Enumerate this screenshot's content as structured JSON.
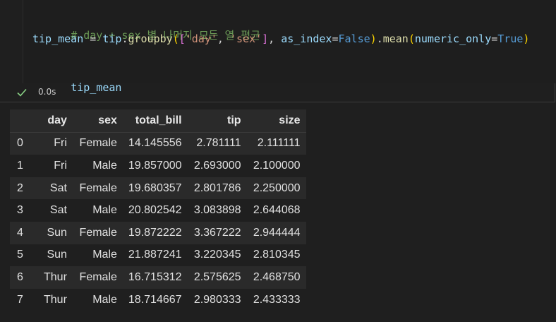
{
  "code": {
    "comment": "# day + sex 별 나머지 모든 열 평균",
    "line2": {
      "var": "tip_mean",
      "eq": " = ",
      "obj": "tip",
      "dot1": ".",
      "method1": "groupby",
      "open_paren": "(",
      "open_bracket": "[",
      "str1": "'day'",
      "comma1": ", ",
      "str2": "'sex'",
      "close_bracket": "]",
      "comma2": ", ",
      "kwarg1": "as_index",
      "eq2": "=",
      "val1": "False",
      "close_paren": ")",
      "dot2": ".",
      "method2": "mean",
      "open_paren2": "(",
      "kwarg2": "numeric_only",
      "eq3": "=",
      "val2": "True",
      "close_paren2": ")"
    },
    "line4": "tip_mean"
  },
  "status": {
    "icon": "check-icon",
    "time": "0.0s",
    "success_color": "#89d185"
  },
  "table": {
    "columns": [
      "",
      "day",
      "sex",
      "total_bill",
      "tip",
      "size"
    ],
    "rows": [
      [
        "0",
        "Fri",
        "Female",
        "14.145556",
        "2.781111",
        "2.111111"
      ],
      [
        "1",
        "Fri",
        "Male",
        "19.857000",
        "2.693000",
        "2.100000"
      ],
      [
        "2",
        "Sat",
        "Female",
        "19.680357",
        "2.801786",
        "2.250000"
      ],
      [
        "3",
        "Sat",
        "Male",
        "20.802542",
        "3.083898",
        "2.644068"
      ],
      [
        "4",
        "Sun",
        "Female",
        "19.872222",
        "3.367222",
        "2.944444"
      ],
      [
        "5",
        "Sun",
        "Male",
        "21.887241",
        "3.220345",
        "2.810345"
      ],
      [
        "6",
        "Thur",
        "Female",
        "16.715312",
        "2.575625",
        "2.468750"
      ],
      [
        "7",
        "Thur",
        "Male",
        "18.714667",
        "2.980333",
        "2.433333"
      ]
    ]
  }
}
